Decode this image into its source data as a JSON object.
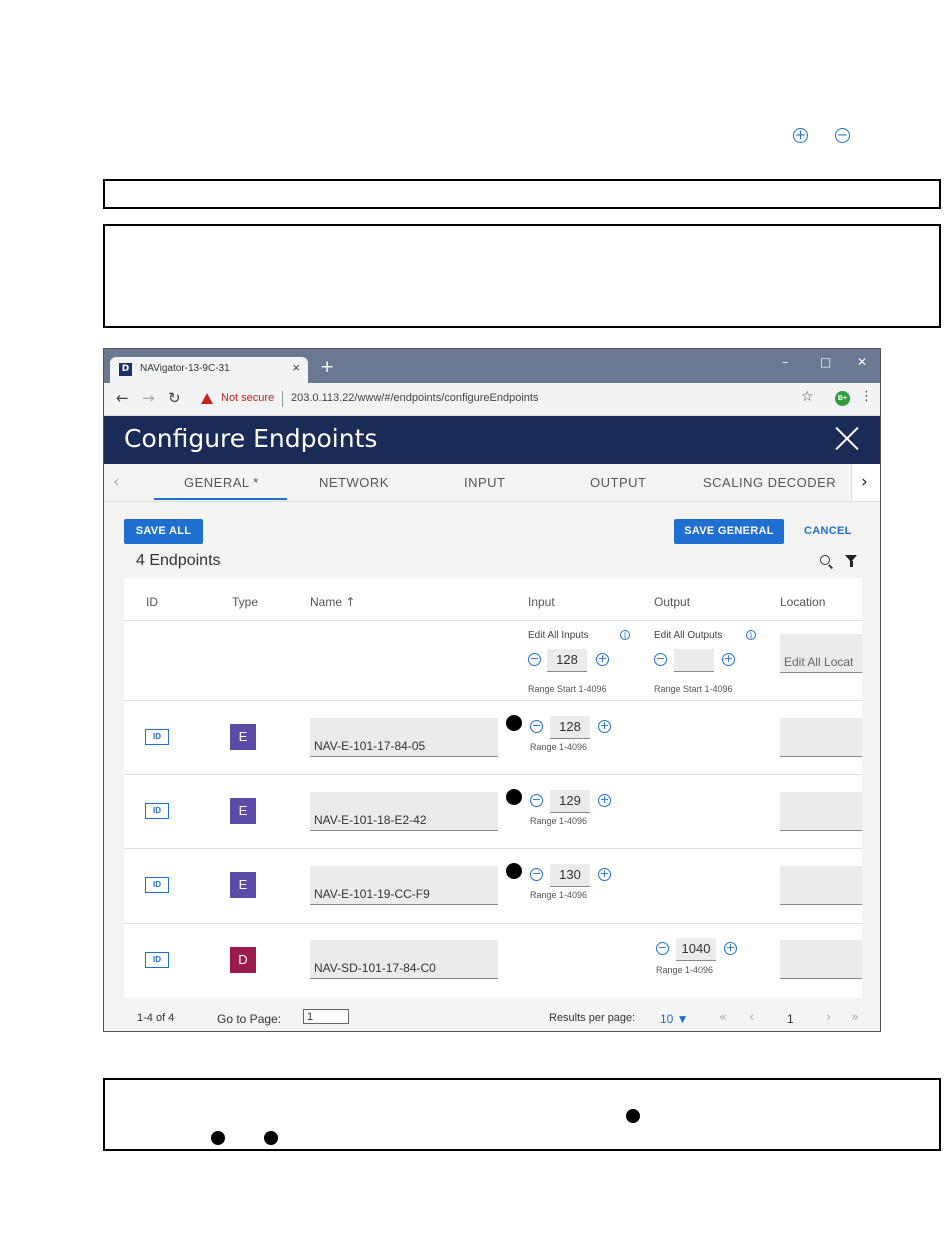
{
  "browser": {
    "tab_title": "NAVigator-13-9C-31",
    "tab_favicon_letter": "D",
    "not_secure": "Not secure",
    "url": "203.0.113.22/www/#/endpoints/configureEndpoints",
    "ext_label": "B+"
  },
  "app": {
    "title": "Configure Endpoints",
    "tabs": [
      "GENERAL *",
      "NETWORK",
      "INPUT",
      "OUTPUT",
      "SCALING DECODER"
    ],
    "save_all": "SAVE ALL",
    "save_general": "SAVE GENERAL",
    "cancel": "CANCEL",
    "count": "4 Endpoints"
  },
  "table": {
    "headers": {
      "id": "ID",
      "type": "Type",
      "name": "Name",
      "input": "Input",
      "output": "Output",
      "location": "Location"
    },
    "bulk": {
      "edit_all_inputs": "Edit All Inputs",
      "edit_all_outputs": "Edit All Outputs",
      "input_value": "128",
      "output_value": "",
      "input_range": "Range Start 1-4096",
      "output_range": "Range Start 1-4096",
      "location_placeholder": "Edit All Locat"
    },
    "rows": [
      {
        "id_label": "ID",
        "type": "E",
        "name": "NAV-E-101-17-84-05",
        "input": "128",
        "range": "Range 1-4096"
      },
      {
        "id_label": "ID",
        "type": "E",
        "name": "NAV-E-101-18-E2-42",
        "input": "129",
        "range": "Range 1-4096"
      },
      {
        "id_label": "ID",
        "type": "E",
        "name": "NAV-E-101-19-CC-F9",
        "input": "130",
        "range": "Range 1-4096"
      },
      {
        "id_label": "ID",
        "type": "D",
        "name": "NAV-SD-101-17-84-C0",
        "output": "1040",
        "range": "Range 1-4096"
      }
    ]
  },
  "footer": {
    "range": "1-4 of 4",
    "goto_label": "Go to Page:",
    "goto_value": "1",
    "results_label": "Results per page:",
    "results_value": "10 ▼",
    "current_page": "1"
  },
  "colors": {
    "accent": "#1f6fd1",
    "header": "#1b2b57",
    "encoder": "#5b4aa6",
    "decoder": "#9b1b4d"
  }
}
